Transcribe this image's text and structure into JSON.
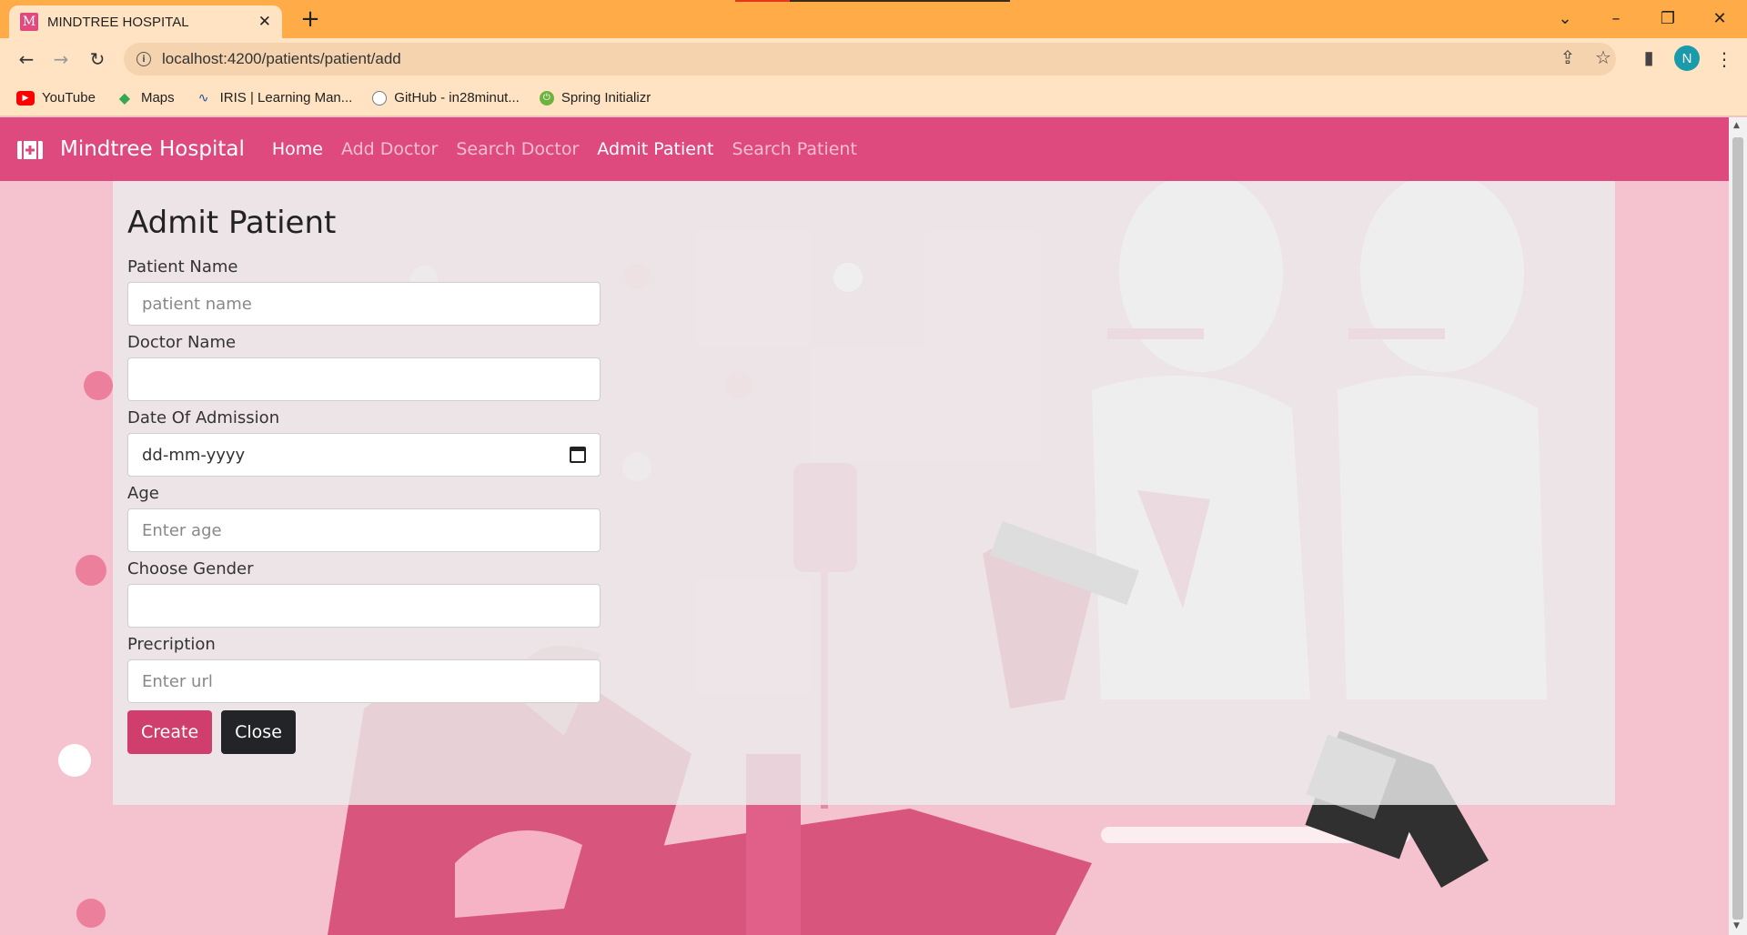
{
  "browser": {
    "tab_title": "MINDTREE HOSPITAL",
    "tab_favicon": "M",
    "url": "localhost:4200/patients/patient/add",
    "profile_initial": "N",
    "bookmarks": [
      {
        "label": "YouTube",
        "icon": "youtube-icon"
      },
      {
        "label": "Maps",
        "icon": "maps-icon"
      },
      {
        "label": "IRIS | Learning Man...",
        "icon": "iris-icon"
      },
      {
        "label": "GitHub - in28minut...",
        "icon": "github-icon"
      },
      {
        "label": "Spring Initializr",
        "icon": "spring-icon"
      }
    ]
  },
  "navbar": {
    "brand": "Mindtree Hospital",
    "links": [
      {
        "label": "Home",
        "active": true
      },
      {
        "label": "Add Doctor",
        "active": false
      },
      {
        "label": "Search Doctor",
        "active": false
      },
      {
        "label": "Admit Patient",
        "active": true
      },
      {
        "label": "Search Patient",
        "active": false
      }
    ]
  },
  "form": {
    "title": "Admit Patient",
    "patient_name": {
      "label": "Patient Name",
      "placeholder": "patient name",
      "value": ""
    },
    "doctor_name": {
      "label": "Doctor Name",
      "value": ""
    },
    "date_of_admission": {
      "label": "Date Of Admission",
      "placeholder": "dd-mm-yyyy"
    },
    "age": {
      "label": "Age",
      "placeholder": "Enter age"
    },
    "gender": {
      "label": "Choose Gender",
      "value": ""
    },
    "prescription": {
      "label": "Precription",
      "placeholder": "Enter url"
    },
    "create_label": "Create",
    "close_label": "Close"
  },
  "colors": {
    "title_bar": "#ffab48",
    "navbar": "#de4a7d",
    "create_button": "#cf3e6d",
    "close_button": "#222428",
    "page_background": "#f4c3cf"
  }
}
